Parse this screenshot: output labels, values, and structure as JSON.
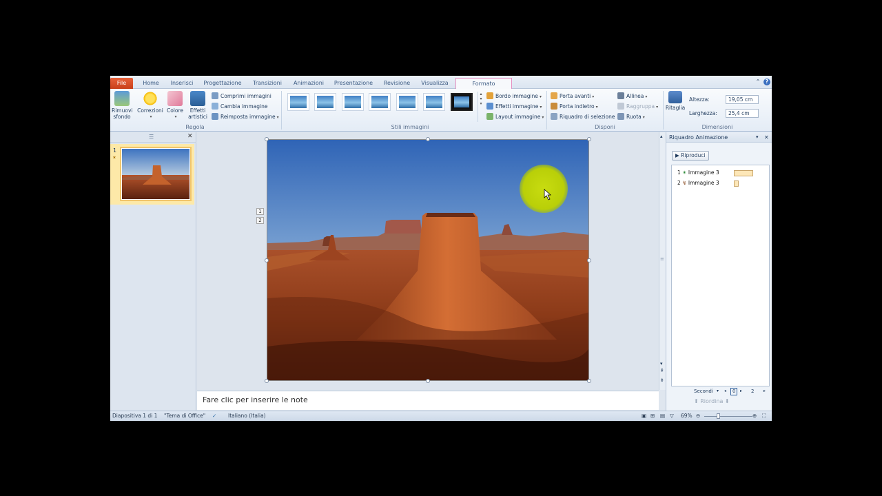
{
  "tabs": [
    "File",
    "Home",
    "Inserisci",
    "Progettazione",
    "Transizioni",
    "Animazioni",
    "Presentazione",
    "Revisione",
    "Visualizza",
    "Formato"
  ],
  "active_tab": "Formato",
  "ribbon": {
    "regola": {
      "label": "Regola",
      "rimuovi_sfondo": "Rimuovi sfondo",
      "correzioni": "Correzioni",
      "colore": "Colore",
      "effetti_artistici": "Effetti artistici",
      "comprimi": "Comprimi immagini",
      "cambia": "Cambia immagine",
      "reimposta": "Reimposta immagine"
    },
    "stili": {
      "label": "Stili immagini",
      "bordo": "Bordo immagine",
      "effetti": "Effetti immagine",
      "layout": "Layout immagine"
    },
    "disponi": {
      "label": "Disponi",
      "porta_avanti": "Porta avanti",
      "porta_indietro": "Porta indietro",
      "riquadro": "Riquadro di selezione",
      "allinea": "Allinea",
      "raggruppa": "Raggruppa",
      "ruota": "Ruota"
    },
    "dimensioni": {
      "label": "Dimensioni",
      "ritaglia": "Ritaglia",
      "altezza_label": "Altezza:",
      "altezza_value": "19,05 cm",
      "larghezza_label": "Larghezza:",
      "larghezza_value": "25,4 cm"
    }
  },
  "slides_panel": {
    "slide_number": "1"
  },
  "slide": {
    "anim_tag_1": "1",
    "anim_tag_2": "2"
  },
  "notes_placeholder": "Fare clic per inserire le note",
  "animation_pane": {
    "title": "Riquadro Animazione",
    "play_label": "Riproduci",
    "items": [
      {
        "index": "1",
        "name": "Immagine 3",
        "duration": 1.0
      },
      {
        "index": "2",
        "name": "Immagine 3",
        "duration": 0.25
      }
    ],
    "timing_unit": "Secondi",
    "timing_start": "0",
    "timing_end": "2",
    "reorder_label": "Riordina"
  },
  "status": {
    "slide": "Diapositiva 1 di 1",
    "theme": "\"Tema di Office\"",
    "language": "Italiano (Italia)",
    "zoom": "69%"
  },
  "colors": {
    "file_tab": "#d9542c",
    "active_tab_border": "#e68fc0",
    "ribbon_bg": "#eef3f9"
  }
}
